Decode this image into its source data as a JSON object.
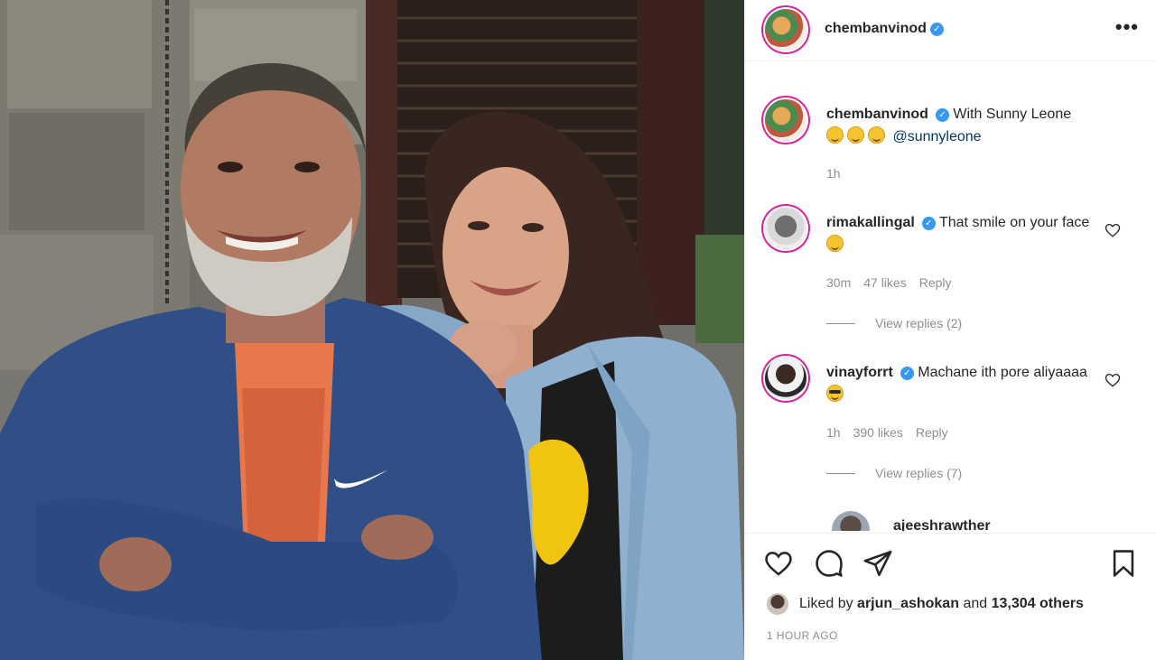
{
  "post": {
    "author": "chembanvinod",
    "author_verified": true,
    "more_icon": "more-options-icon",
    "caption": {
      "username": "chembanvinod",
      "text": "With Sunny Leone",
      "emojis": [
        "smiling-face",
        "smiling-face",
        "smiling-face"
      ],
      "mention": "@sunnyleone",
      "time": "1h"
    },
    "comments": [
      {
        "username": "rimakallingal",
        "verified": true,
        "text": "That smile on your face",
        "emoji": "smiling-face-with-heart-eyes",
        "time": "30m",
        "likes": "47 likes",
        "reply_label": "Reply",
        "view_replies": "View replies (2)"
      },
      {
        "username": "vinayforrt",
        "verified": true,
        "text": "Machane ith pore aliyaaaa",
        "emoji": "smiling-face-with-sunglasses",
        "time": "1h",
        "likes": "390 likes",
        "reply_label": "Reply",
        "view_replies": "View replies (7)"
      },
      {
        "username": "ajeeshrawther",
        "verified": false,
        "text": "",
        "partial": true
      }
    ],
    "actions": {
      "like_icon": "heart-icon",
      "comment_icon": "comment-icon",
      "share_icon": "share-icon",
      "save_icon": "bookmark-icon"
    },
    "liked_by": {
      "prefix": "Liked by",
      "user": "arjun_ashokan",
      "connector": "and",
      "others": "13,304 others"
    },
    "posted_ago": "1 HOUR AGO"
  },
  "colors": {
    "verified_blue": "#3897f0",
    "text": "#262626",
    "secondary_text": "#8e8e8e",
    "mention": "#00376b",
    "story_ring": "#d6249f"
  }
}
